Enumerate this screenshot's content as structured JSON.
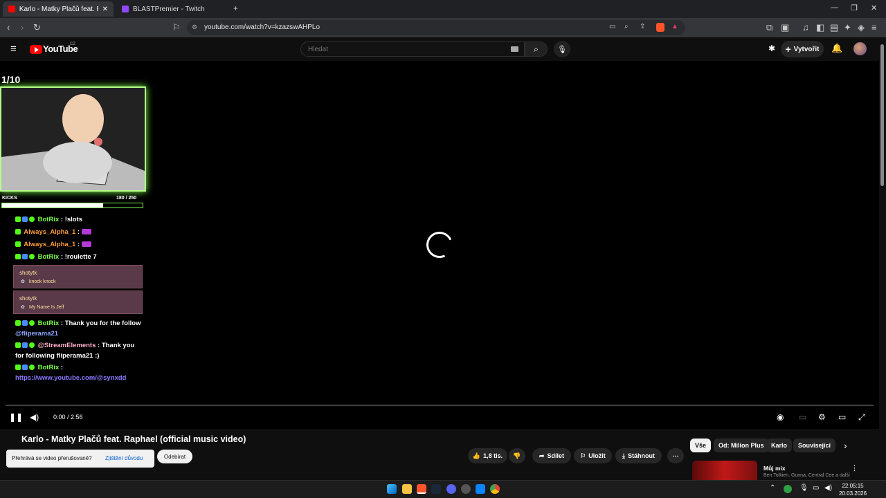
{
  "browser": {
    "tabs": [
      {
        "label": "Karlo - Matky Plačů feat. Raphae",
        "active": true
      },
      {
        "label": "BLASTPremier - Twitch",
        "active": false
      }
    ],
    "url": "youtube.com/watch?v=kzazswAHPLo"
  },
  "youtube": {
    "logo_text": "YouTube",
    "region": "CZ",
    "search_placeholder": "Hledat",
    "create_label": "Vytvořit"
  },
  "overlay": {
    "counter": "1/10",
    "kicks_label": "KICKS",
    "kicks_count": "180  / 250",
    "kicks_progress": 0.72,
    "chat": [
      {
        "user": "BotRix",
        "text": "!slots",
        "color": "#7dff4a"
      },
      {
        "user": "Always_Alpha_1",
        "text": "",
        "color": "#ff9e3d"
      },
      {
        "user": "Always_Alpha_1",
        "text": "",
        "color": "#ff9e3d"
      },
      {
        "user": "BotRix",
        "text": "!roulette 7",
        "color": "#7dff4a"
      }
    ],
    "boxes": [
      {
        "user": "shotytk",
        "text": "knock knock"
      },
      {
        "user": "shotytk",
        "text": "My Name Is Jeff"
      }
    ],
    "chat2": [
      {
        "user": "BotRix",
        "text": "Thank you for the follow",
        "line2": "@fliperama21",
        "color": "#7dff4a"
      },
      {
        "user": "@StreamElements",
        "text": "Thank you",
        "line2": "for following fliperama21 :)",
        "color": "#ffb0c8"
      },
      {
        "user": "BotRix",
        "text": "",
        "line2": "https://www.youtube.com/@synxdd",
        "color": "#7dff4a"
      }
    ]
  },
  "player": {
    "time": "0:00 / 2:56"
  },
  "video": {
    "title": "Karlo - Matky Plačů feat. Raphael (official music video)",
    "likes": "1,8 tis.",
    "share": "Sdílet",
    "save": "Uložit",
    "download": "Stáhnout"
  },
  "chips": [
    "Vše",
    "Od: Milion Plus",
    "Karlo",
    "Související"
  ],
  "toast": {
    "question": "Přehrává se video přerušovaně?",
    "link": "Zjištění důvodu",
    "button": "Odebírat"
  },
  "mix": {
    "title": "Můj mix",
    "subtitle": "Ben Tolkien, Gunna, Central Cee a další"
  },
  "taskbar": {
    "time": "22:05:15",
    "date": "20.03.2026"
  },
  "colors": {
    "youtube_red": "#ff0000",
    "accent_green": "#7dff4a"
  }
}
